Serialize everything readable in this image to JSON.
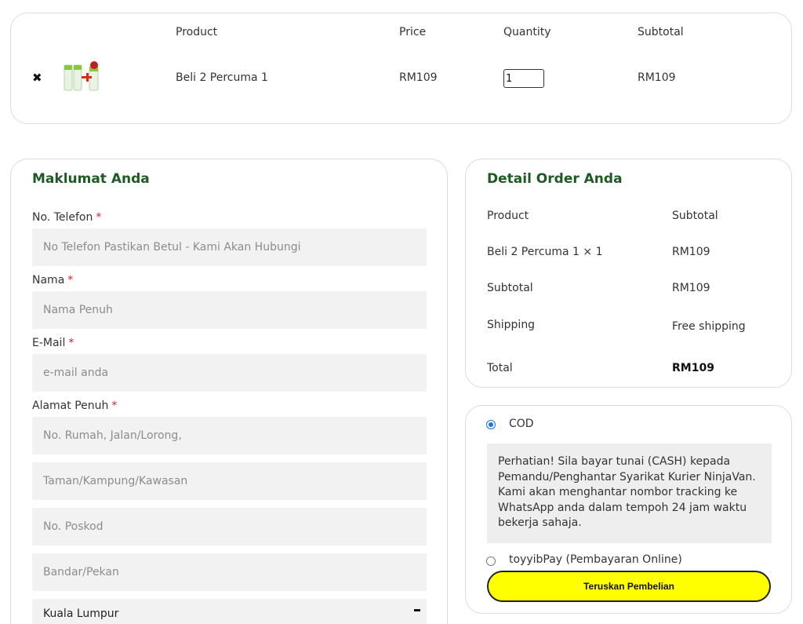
{
  "cart": {
    "headers": {
      "product": "Product",
      "price": "Price",
      "quantity": "Quantity",
      "subtotal": "Subtotal"
    },
    "item": {
      "name": "Beli 2 Percuma 1",
      "price": "RM109",
      "quantity": "1",
      "subtotal": "RM109",
      "remove_icon": "close-icon"
    }
  },
  "billing": {
    "title": "Maklumat Anda",
    "required_mark": "*",
    "phone_label": "No. Telefon",
    "phone_placeholder": "No Telefon Pastikan Betul - Kami Akan Hubungi",
    "name_label": "Nama",
    "name_placeholder": "Nama Penuh",
    "email_label": "E-Mail",
    "email_placeholder": "e-mail anda",
    "address_label": "Alamat Penuh",
    "address1_placeholder": "No. Rumah, Jalan/Lorong,",
    "address2_placeholder": "Taman/Kampung/Kawasan",
    "postcode_placeholder": "No. Poskod",
    "city_placeholder": "Bandar/Pekan",
    "state_value": "Kuala Lumpur"
  },
  "review": {
    "title": "Detail Order Anda",
    "col_product": "Product",
    "col_subtotal": "Subtotal",
    "item_name": "Beli 2 Percuma 1  × 1",
    "item_subtotal": "RM109",
    "subtotal_label": "Subtotal",
    "subtotal_value": "RM109",
    "shipping_label": "Shipping",
    "shipping_value": "Free shipping",
    "total_label": "Total",
    "total_value": "RM109"
  },
  "payment": {
    "cod_label": "COD",
    "cod_note": "Perhatian! Sila bayar tunai (CASH) kepada Pemandu/Penghantar Syarikat Kurier NinjaVan. Kami akan menghantar nombor tracking ke WhatsApp anda dalam tempoh 24 jam waktu bekerja sahaja.",
    "toyyib_label": "toyyibPay (Pembayaran Online)",
    "place_order": "Teruskan Pembelian"
  },
  "colors": {
    "accent_green": "#1e5b22",
    "button_yellow": "#ffff00",
    "required_red": "#d8232a",
    "radio_blue": "#1a73e8"
  }
}
